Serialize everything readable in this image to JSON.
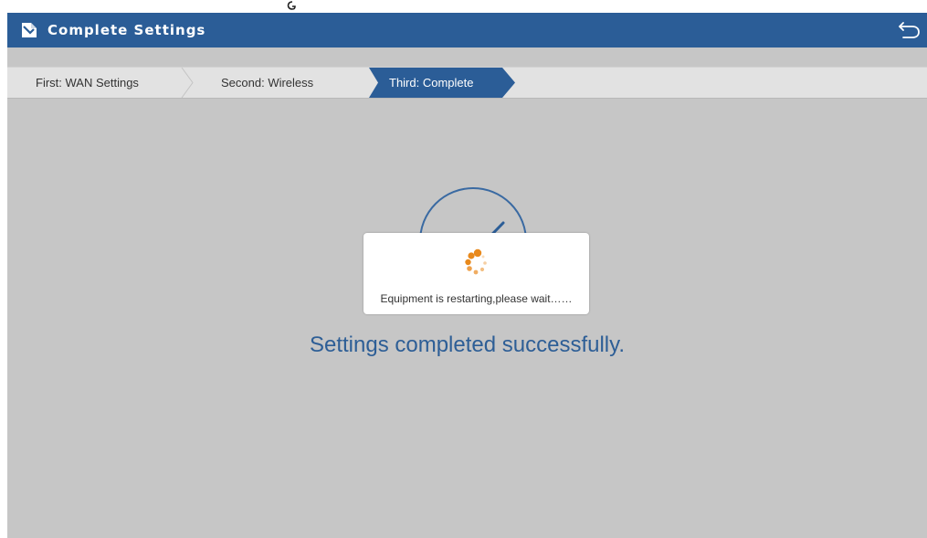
{
  "header": {
    "title": "Complete Settings",
    "title_icon": "document-icon",
    "back_icon": "return-arrow-icon",
    "background": "#2b5d97"
  },
  "steps": [
    {
      "label": "First: WAN Settings",
      "active": false
    },
    {
      "label": "Second: Wireless",
      "active": false
    },
    {
      "label": "Third: Complete",
      "active": true
    }
  ],
  "main": {
    "status_icon": "checkmark-circle-icon",
    "success_message": "Settings completed successfully."
  },
  "dialog": {
    "spinner_icon": "loading-spinner-icon",
    "message": "Equipment is restarting,please wait……"
  },
  "colors": {
    "accent": "#2b5d97",
    "spinner": "#e8891c",
    "background": "#c6c6c6"
  }
}
